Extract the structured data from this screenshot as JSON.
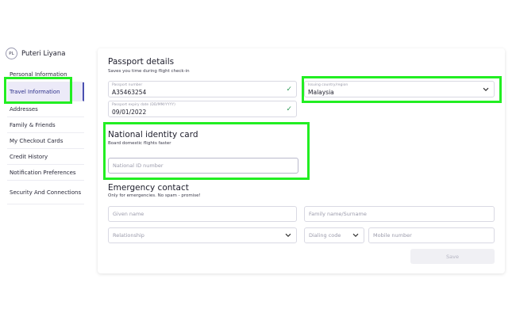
{
  "user": {
    "initials": "PL",
    "name": "Puteri Liyana"
  },
  "sidebar": {
    "items": [
      {
        "label": "Personal Information"
      },
      {
        "label": "Travel Information"
      },
      {
        "label": "Addresses"
      },
      {
        "label": "Family & Friends"
      },
      {
        "label": "My Checkout Cards"
      },
      {
        "label": "Credit History"
      },
      {
        "label": "Notification Preferences"
      },
      {
        "label": "Security And Connections"
      }
    ]
  },
  "passport": {
    "title": "Passport details",
    "subtitle": "Saves you time during flight check-in",
    "number_label": "Passport number",
    "number_value": "A35463254",
    "country_label": "Issuing country/region",
    "country_value": "Malaysia",
    "expiry_label": "Passport expiry date (DD/MM/YYYY)",
    "expiry_value": "09/01/2022"
  },
  "national_id": {
    "title": "National identity card",
    "subtitle": "Board domestic flights faster",
    "placeholder": "National ID number"
  },
  "emergency": {
    "title": "Emergency contact",
    "subtitle": "Only for emergencies. No spam - promise!",
    "given_name_placeholder": "Given name",
    "family_name_placeholder": "Family name/Surname",
    "relationship_placeholder": "Relationship",
    "dialing_code_placeholder": "Dialing code",
    "mobile_placeholder": "Mobile number"
  },
  "save_label": "Save",
  "colors": {
    "accent": "#4a4fb0",
    "highlight": "#22ee22",
    "check": "#2f9c5a"
  }
}
